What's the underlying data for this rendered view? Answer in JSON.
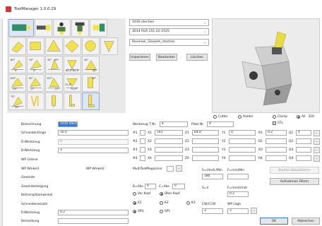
{
  "window": {
    "title": "ToolManager 1.0.0.29"
  },
  "tool_icons": {
    "row3": [
      {
        "cap1": "85°",
        "cap2": "5°"
      },
      {
        "cap1": "75°",
        "cap2": "5°"
      },
      {
        "cap1": "34°",
        "cap2": "93°"
      },
      {
        "cap1": "62,5°",
        "cap2": "62,5°"
      },
      {
        "cap1": "45°",
        "cap2": "45°"
      }
    ],
    "row4": [
      {
        "cap1": "105°",
        "cap2": "-15°"
      },
      {
        "cap1": "92°",
        "cap2": "-2°"
      },
      {
        "cap1": "107°",
        "cap2": "-17°"
      },
      {
        "cap1": "72,5°",
        "cap2": "72,5°"
      },
      {
        "cap1": "",
        "cap2": "30°"
      }
    ],
    "row5": [
      {
        "cap1": "75°",
        "cap2": "15°"
      }
    ]
  },
  "combos": {
    "combo1": "1010 stechen",
    "combo2": "3014 RLR 151.22-2525",
    "combo3": "Revolver_Gesamt_stechen"
  },
  "buttons": {
    "importieren": "Importieren",
    "bearbeiten": "Bearbeiten",
    "loeschen": "Löschen",
    "bauteil": "Bauteil aktualisieren",
    "aufnahmen": "Aufnahmen Filtern",
    "ok": "OK",
    "abbrechen": "Abbrechen",
    "ellipsis": "..."
  },
  "filter": {
    "cutter": "Cutter",
    "holder": "Holder",
    "clamp": "Clamp",
    "all": "All",
    "count": "316",
    "stl": "STL"
  },
  "labels": {
    "bezeichnung": "Bezeichnung",
    "schneidenlaenge": "Schneidenlänge",
    "d_werkzeug": "D-Werkzeug",
    "b_werkzeug": "B-Werkzeug",
    "wp_groesse": "WP Grösse",
    "wp_winkel1": "WP Winkel1",
    "wp_winkel2": "WP Winkel2",
    "gewinde": "Gewinde",
    "gewindesteigung": "Gewindesteigung",
    "bohrerspitzenwinkel": "Bohrerspitzenwinkel",
    "schneidenanzahl": "Schneidenanzahl",
    "r_werkzeug": "R-Werkzeug",
    "bemerkung": "Bemerkung",
    "werkzeug_t": "Werkzeug T Nr.",
    "platz": "Platz Nr.",
    "multi": "MultiToolMagazinnr",
    "s_umdr": "S=Umdr./Min",
    "f_mm": "F=mm/Min",
    "s_v": "S=V",
    "f_umdr": "F=mm/Umdr",
    "b_abs": "B=Abs",
    "c_abs": "C=Abs",
    "vor_kopf": "Vor Kopf",
    "ueber_kopf": "Über Kopf",
    "k1": "K1",
    "k2": "K2",
    "k3": "K3",
    "cw_ccw": "CW/CCW",
    "wp_lage": "WP Lage",
    "sp4": "SP4",
    "sp1": "SP1"
  },
  "values": {
    "bezeichnung": "1010 stechen",
    "schneidenlaenge": "10.0",
    "d_werkzeug": "0",
    "b_werkzeug": "3",
    "r_werkzeug": "0.2",
    "werkzeug_t": "4",
    "platz": "4",
    "s_umdr": "180",
    "f_umdr": "0.2",
    "b_abs": "0",
    "c_abs": "0",
    "cw_ccw": "3",
    "wp_lage": "3"
  },
  "coords": {
    "rows": [
      {
        "n": "#1",
        "x1": "143",
        "z1": "64.8",
        "y1": "0",
        "r1": "0.2",
        "q1": "4"
      },
      {
        "n": "#2",
        "x1": "",
        "z1": "",
        "y1": "",
        "r1": "",
        "q1": ""
      },
      {
        "n": "#3",
        "x1": "",
        "z1": "",
        "y1": "",
        "r1": "",
        "q1": ""
      },
      {
        "n": "#4",
        "x1": "",
        "z1": "",
        "y1": "",
        "r1": "",
        "q1": ""
      }
    ],
    "xlabels": [
      "X1",
      "X2",
      "X3",
      "X4"
    ],
    "zlabels": [
      "Z1",
      "Z2",
      "Z3",
      "Z4"
    ],
    "ylabels": [
      "Y1",
      "Y2",
      "Y3",
      "Y4"
    ],
    "rlabels": [
      "R1",
      "R2",
      "R3",
      "R4"
    ],
    "qlabels": [
      "Q1",
      "Q2",
      "Q3",
      "Q4"
    ]
  },
  "colors": {
    "accent": "#3a78d6",
    "tool_yellow": "#f2e24a",
    "selected": "#dbe7f6"
  }
}
